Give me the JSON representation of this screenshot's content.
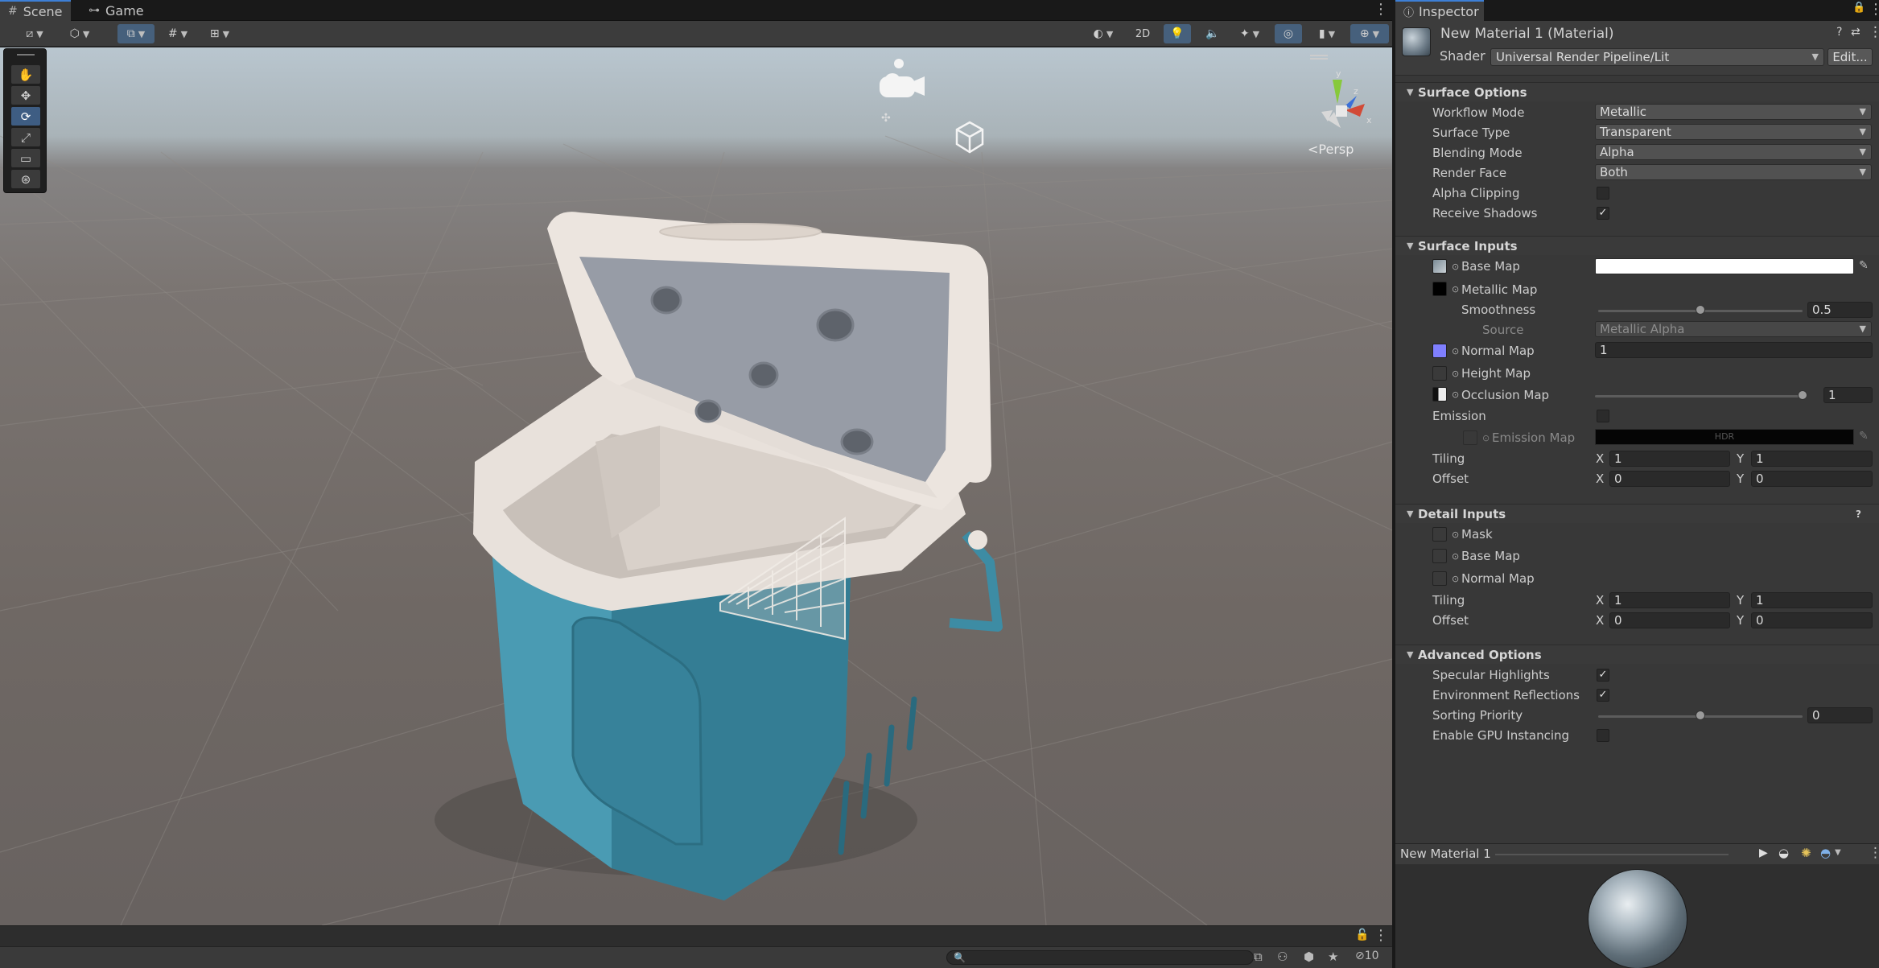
{
  "scene": {
    "tabs": [
      {
        "label": "Scene",
        "icon": "grid-icon"
      },
      {
        "label": "Game",
        "icon": "gamepad-icon"
      }
    ],
    "toolbar": {
      "toggle_2d": "2D"
    },
    "tools": [
      "hand-tool",
      "move-tool",
      "rotate-tool",
      "scale-tool",
      "rect-tool",
      "transform-tool"
    ],
    "active_tool": "rotate-tool",
    "gizmo": {
      "axis_x": "x",
      "axis_y": "y",
      "axis_z": "z",
      "projection": "Persp"
    },
    "bottom": {
      "hidden_count": "10"
    }
  },
  "inspector": {
    "tab_label": "Inspector",
    "material_title": "New Material 1 (Material)",
    "shader_label": "Shader",
    "shader_value": "Universal Render Pipeline/Lit",
    "edit_label": "Edit...",
    "surface_options": {
      "header": "Surface Options",
      "workflow_mode": {
        "label": "Workflow Mode",
        "value": "Metallic"
      },
      "surface_type": {
        "label": "Surface Type",
        "value": "Transparent"
      },
      "blending_mode": {
        "label": "Blending Mode",
        "value": "Alpha"
      },
      "render_face": {
        "label": "Render Face",
        "value": "Both"
      },
      "alpha_clipping": {
        "label": "Alpha Clipping",
        "checked": false
      },
      "receive_shadows": {
        "label": "Receive Shadows",
        "checked": true
      }
    },
    "surface_inputs": {
      "header": "Surface Inputs",
      "base_map": {
        "label": "Base Map",
        "color": "#ffffff"
      },
      "metallic_map": {
        "label": "Metallic Map"
      },
      "smoothness": {
        "label": "Smoothness",
        "value": "0.5",
        "fraction": 0.5
      },
      "source": {
        "label": "Source",
        "value": "Metallic Alpha"
      },
      "normal_map": {
        "label": "Normal Map",
        "value": "1",
        "swatch": "#8080ff"
      },
      "height_map": {
        "label": "Height Map"
      },
      "occlusion_map": {
        "label": "Occlusion Map",
        "value": "1",
        "fraction": 1.0
      },
      "emission": {
        "label": "Emission",
        "checked": false
      },
      "emission_map": {
        "label": "Emission Map",
        "hdr": "HDR"
      },
      "tiling": {
        "label": "Tiling",
        "x": "1",
        "y": "1"
      },
      "offset": {
        "label": "Offset",
        "x": "0",
        "y": "0"
      },
      "x_label": "X",
      "y_label": "Y"
    },
    "detail_inputs": {
      "header": "Detail Inputs",
      "mask": {
        "label": "Mask"
      },
      "base_map": {
        "label": "Base Map"
      },
      "normal_map": {
        "label": "Normal Map"
      },
      "tiling": {
        "label": "Tiling",
        "x": "1",
        "y": "1"
      },
      "offset": {
        "label": "Offset",
        "x": "0",
        "y": "0"
      }
    },
    "advanced_options": {
      "header": "Advanced Options",
      "specular_highlights": {
        "label": "Specular Highlights",
        "checked": true
      },
      "environment_reflections": {
        "label": "Environment Reflections",
        "checked": true
      },
      "sorting_priority": {
        "label": "Sorting Priority",
        "value": "0",
        "fraction": 0.5
      },
      "gpu_instancing": {
        "label": "Enable GPU Instancing",
        "checked": false
      }
    },
    "preview": {
      "title": "New Material 1"
    }
  },
  "colors": {
    "accent_blue": "#3d7fd6",
    "cooler_body": "#3f8ea6",
    "cooler_lid": "#e4dcd6",
    "panel_bg": "#383838"
  }
}
